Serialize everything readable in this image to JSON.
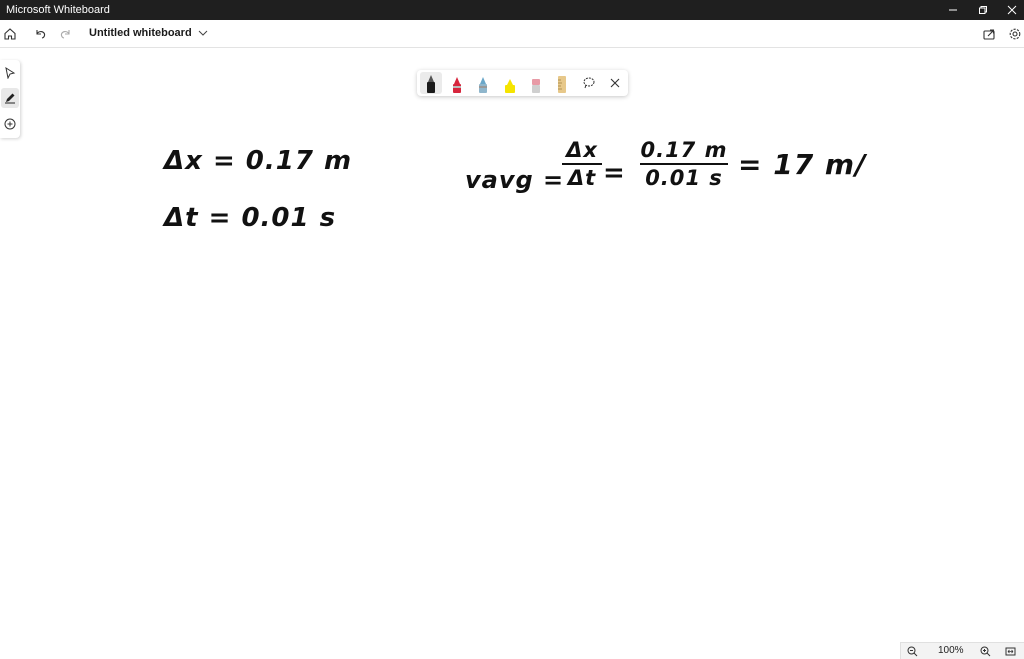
{
  "window": {
    "title": "Microsoft Whiteboard",
    "controls": [
      "minimize-icon",
      "restore-icon",
      "close-icon"
    ]
  },
  "toolbar": {
    "board_title": "Untitled whiteboard",
    "left_icons": [
      "home-icon",
      "undo-icon",
      "redo-icon"
    ],
    "right_icons": [
      "share-icon",
      "settings-icon"
    ]
  },
  "left_rail": {
    "tools": [
      "select-icon",
      "pen-icon",
      "add-icon"
    ],
    "active": "pen-icon"
  },
  "pen_palette": {
    "pens": [
      {
        "name": "black-pen",
        "color": "#1a1a1a",
        "active": true
      },
      {
        "name": "red-pen",
        "color": "#d7263d"
      },
      {
        "name": "blue-pen",
        "color": "#6aa7c9"
      },
      {
        "name": "yellow-highlighter",
        "color": "#f5e400"
      },
      {
        "name": "pink-pen",
        "color": "#e89aa6"
      },
      {
        "name": "ruler",
        "color": "#e7c88a"
      }
    ],
    "tools": [
      "lasso-icon",
      "close-icon"
    ]
  },
  "canvas": {
    "lines": [
      {
        "text": "Δx = 0.17 m"
      },
      {
        "text": "Δt = 0.01 s"
      },
      {
        "text": "vavg ="
      },
      {
        "numerator": "Δx",
        "denominator": "Δt"
      },
      {
        "text": "="
      },
      {
        "numerator": "0.17 m",
        "denominator": "0.01 s"
      },
      {
        "text": "= 17 m/"
      }
    ]
  },
  "zoom": {
    "value": "100%",
    "icons": [
      "zoom-out-icon",
      "zoom-in-icon",
      "fit-icon"
    ]
  }
}
